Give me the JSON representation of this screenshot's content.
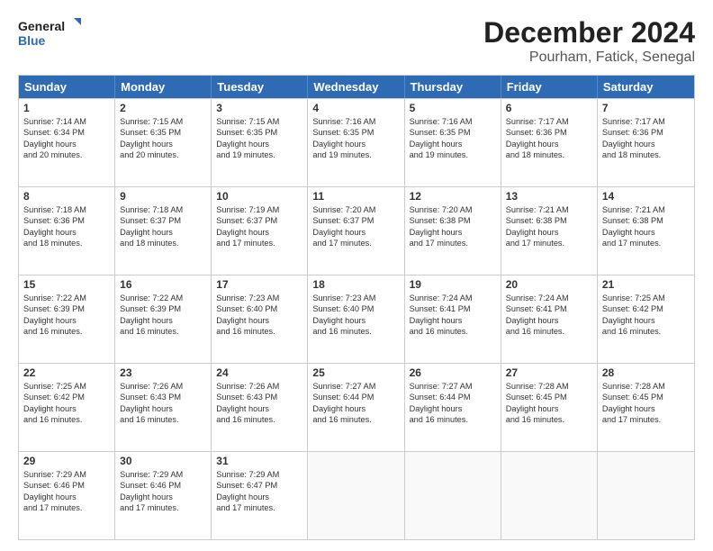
{
  "header": {
    "logo": {
      "line1": "General",
      "line2": "Blue"
    },
    "title": "December 2024",
    "subtitle": "Pourham, Fatick, Senegal"
  },
  "calendar": {
    "days_of_week": [
      "Sunday",
      "Monday",
      "Tuesday",
      "Wednesday",
      "Thursday",
      "Friday",
      "Saturday"
    ],
    "weeks": [
      [
        {
          "day": null
        },
        {
          "day": null
        },
        {
          "day": null
        },
        {
          "day": null
        },
        {
          "day": null
        },
        {
          "day": null
        },
        {
          "day": null
        }
      ],
      [
        {
          "day": 1,
          "sunrise": "7:14 AM",
          "sunset": "6:34 PM",
          "daylight": "11 hours and 20 minutes."
        },
        {
          "day": 2,
          "sunrise": "7:15 AM",
          "sunset": "6:35 PM",
          "daylight": "11 hours and 20 minutes."
        },
        {
          "day": 3,
          "sunrise": "7:15 AM",
          "sunset": "6:35 PM",
          "daylight": "11 hours and 19 minutes."
        },
        {
          "day": 4,
          "sunrise": "7:16 AM",
          "sunset": "6:35 PM",
          "daylight": "11 hours and 19 minutes."
        },
        {
          "day": 5,
          "sunrise": "7:16 AM",
          "sunset": "6:35 PM",
          "daylight": "11 hours and 19 minutes."
        },
        {
          "day": 6,
          "sunrise": "7:17 AM",
          "sunset": "6:36 PM",
          "daylight": "11 hours and 18 minutes."
        },
        {
          "day": 7,
          "sunrise": "7:17 AM",
          "sunset": "6:36 PM",
          "daylight": "11 hours and 18 minutes."
        }
      ],
      [
        {
          "day": 8,
          "sunrise": "7:18 AM",
          "sunset": "6:36 PM",
          "daylight": "11 hours and 18 minutes."
        },
        {
          "day": 9,
          "sunrise": "7:18 AM",
          "sunset": "6:37 PM",
          "daylight": "11 hours and 18 minutes."
        },
        {
          "day": 10,
          "sunrise": "7:19 AM",
          "sunset": "6:37 PM",
          "daylight": "11 hours and 17 minutes."
        },
        {
          "day": 11,
          "sunrise": "7:20 AM",
          "sunset": "6:37 PM",
          "daylight": "11 hours and 17 minutes."
        },
        {
          "day": 12,
          "sunrise": "7:20 AM",
          "sunset": "6:38 PM",
          "daylight": "11 hours and 17 minutes."
        },
        {
          "day": 13,
          "sunrise": "7:21 AM",
          "sunset": "6:38 PM",
          "daylight": "11 hours and 17 minutes."
        },
        {
          "day": 14,
          "sunrise": "7:21 AM",
          "sunset": "6:38 PM",
          "daylight": "11 hours and 17 minutes."
        }
      ],
      [
        {
          "day": 15,
          "sunrise": "7:22 AM",
          "sunset": "6:39 PM",
          "daylight": "11 hours and 16 minutes."
        },
        {
          "day": 16,
          "sunrise": "7:22 AM",
          "sunset": "6:39 PM",
          "daylight": "11 hours and 16 minutes."
        },
        {
          "day": 17,
          "sunrise": "7:23 AM",
          "sunset": "6:40 PM",
          "daylight": "11 hours and 16 minutes."
        },
        {
          "day": 18,
          "sunrise": "7:23 AM",
          "sunset": "6:40 PM",
          "daylight": "11 hours and 16 minutes."
        },
        {
          "day": 19,
          "sunrise": "7:24 AM",
          "sunset": "6:41 PM",
          "daylight": "11 hours and 16 minutes."
        },
        {
          "day": 20,
          "sunrise": "7:24 AM",
          "sunset": "6:41 PM",
          "daylight": "11 hours and 16 minutes."
        },
        {
          "day": 21,
          "sunrise": "7:25 AM",
          "sunset": "6:42 PM",
          "daylight": "11 hours and 16 minutes."
        }
      ],
      [
        {
          "day": 22,
          "sunrise": "7:25 AM",
          "sunset": "6:42 PM",
          "daylight": "11 hours and 16 minutes."
        },
        {
          "day": 23,
          "sunrise": "7:26 AM",
          "sunset": "6:43 PM",
          "daylight": "11 hours and 16 minutes."
        },
        {
          "day": 24,
          "sunrise": "7:26 AM",
          "sunset": "6:43 PM",
          "daylight": "11 hours and 16 minutes."
        },
        {
          "day": 25,
          "sunrise": "7:27 AM",
          "sunset": "6:44 PM",
          "daylight": "11 hours and 16 minutes."
        },
        {
          "day": 26,
          "sunrise": "7:27 AM",
          "sunset": "6:44 PM",
          "daylight": "11 hours and 16 minutes."
        },
        {
          "day": 27,
          "sunrise": "7:28 AM",
          "sunset": "6:45 PM",
          "daylight": "11 hours and 16 minutes."
        },
        {
          "day": 28,
          "sunrise": "7:28 AM",
          "sunset": "6:45 PM",
          "daylight": "11 hours and 17 minutes."
        }
      ],
      [
        {
          "day": 29,
          "sunrise": "7:29 AM",
          "sunset": "6:46 PM",
          "daylight": "11 hours and 17 minutes."
        },
        {
          "day": 30,
          "sunrise": "7:29 AM",
          "sunset": "6:46 PM",
          "daylight": "11 hours and 17 minutes."
        },
        {
          "day": 31,
          "sunrise": "7:29 AM",
          "sunset": "6:47 PM",
          "daylight": "11 hours and 17 minutes."
        },
        {
          "day": null
        },
        {
          "day": null
        },
        {
          "day": null
        },
        {
          "day": null
        }
      ]
    ]
  }
}
